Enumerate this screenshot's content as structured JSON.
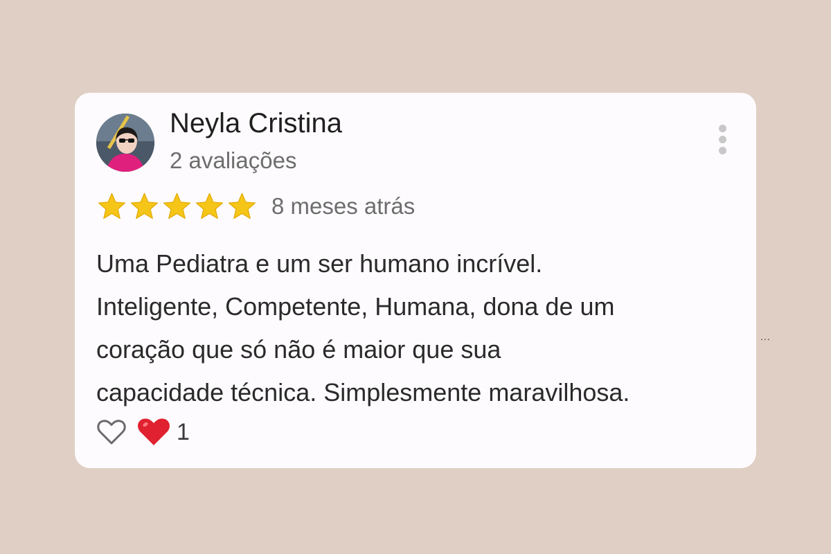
{
  "review": {
    "reviewer_name": "Neyla Cristina",
    "review_count": "2 avaliações",
    "rating": 5,
    "rating_max": 5,
    "date": "8 meses atrás",
    "text_lines": [
      "Uma Pediatra e um ser humano incrível.",
      "Inteligente, Competente, Humana, dona de um",
      "coração que só não é maior que sua",
      "capacidade técnica. Simplesmente maravilhosa."
    ],
    "reactions": {
      "like_icon": "heart-outline-icon",
      "love_icon": "red-heart-icon",
      "count": "1"
    },
    "menu_icon": "vertical-dots-icon"
  },
  "outside_mark": "...",
  "colors": {
    "background": "#e0cfc4",
    "card": "#fdfbfd",
    "star": "#f5c518",
    "heart": "#e0212f",
    "muted_text": "#6d6d6d"
  }
}
